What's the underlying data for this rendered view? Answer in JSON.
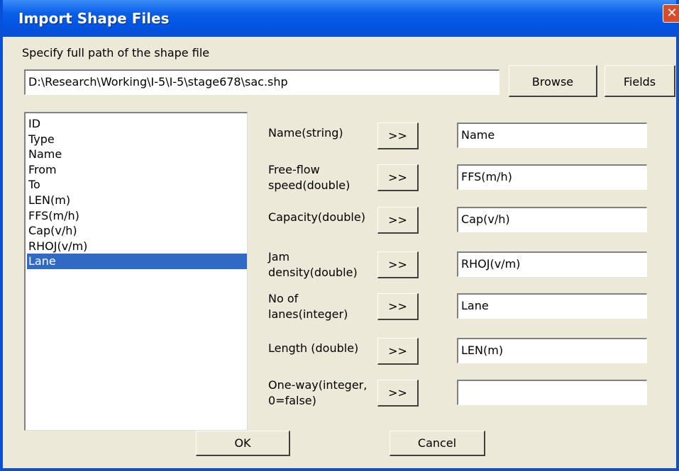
{
  "window": {
    "title": "Import Shape Files"
  },
  "path": {
    "label": "Specify full path of the shape file",
    "value": "D:\\Research\\Working\\I-5\\I-5\\stage678\\sac.shp",
    "browse_label": "Browse",
    "fields_label": "Fields"
  },
  "field_list": {
    "items": [
      "ID",
      "Type",
      "Name",
      "From",
      "To",
      "LEN(m)",
      "FFS(m/h)",
      "Cap(v/h)",
      "RHOJ(v/m)",
      "Lane"
    ],
    "selected": "Lane"
  },
  "mappings": [
    {
      "label": [
        "Name(string)"
      ],
      "button": ">>",
      "value": "Name"
    },
    {
      "label": [
        "Free-flow",
        "speed(double)"
      ],
      "button": ">>",
      "value": "FFS(m/h)"
    },
    {
      "label": [
        "Capacity(double)"
      ],
      "button": ">>",
      "value": "Cap(v/h)"
    },
    {
      "label": [
        "Jam",
        "density(double)"
      ],
      "button": ">>",
      "value": "RHOJ(v/m)"
    },
    {
      "label": [
        "No of",
        "lanes(integer)"
      ],
      "button": ">>",
      "value": "Lane"
    },
    {
      "label": [
        "Length (double)"
      ],
      "button": ">>",
      "value": "LEN(m)"
    },
    {
      "label": [
        "One-way(integer,",
        "0=false)"
      ],
      "button": ">>",
      "value": ""
    }
  ],
  "footer": {
    "ok_label": "OK",
    "cancel_label": "Cancel"
  }
}
